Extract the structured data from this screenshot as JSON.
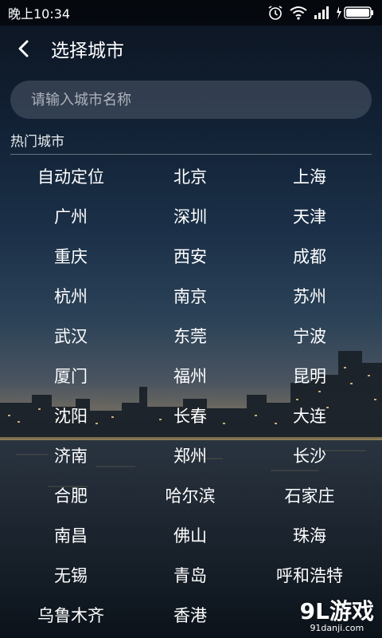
{
  "status_bar": {
    "time": "晚上10:34",
    "icons": [
      "alarm-icon",
      "wifi-icon",
      "signal-icon",
      "battery-charging-icon"
    ]
  },
  "header": {
    "back_icon": "chevron-left-icon",
    "title": "选择城市"
  },
  "search": {
    "placeholder": "请输入城市名称",
    "value": ""
  },
  "hot_section": {
    "title": "热门城市",
    "cities": [
      "自动定位",
      "北京",
      "上海",
      "广州",
      "深圳",
      "天津",
      "重庆",
      "西安",
      "成都",
      "杭州",
      "南京",
      "苏州",
      "武汉",
      "东莞",
      "宁波",
      "厦门",
      "福州",
      "昆明",
      "沈阳",
      "长春",
      "大连",
      "济南",
      "郑州",
      "长沙",
      "合肥",
      "哈尔滨",
      "石家庄",
      "南昌",
      "佛山",
      "珠海",
      "无锡",
      "青岛",
      "呼和浩特",
      "乌鲁木齐",
      "香港",
      ""
    ]
  },
  "watermark": {
    "logo": "9L游戏",
    "url": "91danji.com"
  }
}
